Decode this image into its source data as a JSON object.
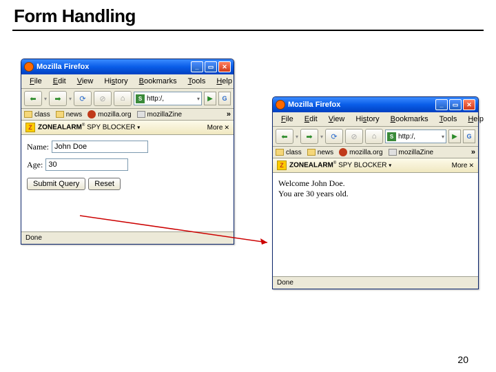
{
  "title": "Form Handling",
  "page_number": "20",
  "win1": {
    "title": "Mozilla Firefox",
    "menu": [
      "File",
      "Edit",
      "View",
      "History",
      "Bookmarks",
      "Tools",
      "Help"
    ],
    "addr": "http:/,",
    "bookmarks": [
      {
        "label": "class",
        "type": "folder"
      },
      {
        "label": "news",
        "type": "folder"
      },
      {
        "label": "mozilla.org",
        "type": "moz"
      },
      {
        "label": "mozillaZine",
        "type": "zine"
      }
    ],
    "za_brand": "ZONEALARM",
    "za_sub": "SPY BLOCKER",
    "za_more": "More",
    "form": {
      "name_label": "Name:",
      "name_value": "John Doe",
      "age_label": "Age:",
      "age_value": "30",
      "submit": "Submit Query",
      "reset": "Reset"
    },
    "status": "Done"
  },
  "win2": {
    "title": "Mozilla Firefox",
    "menu": [
      "File",
      "Edit",
      "View",
      "History",
      "Bookmarks",
      "Tools",
      "Help"
    ],
    "addr": "http:/,",
    "bookmarks": [
      {
        "label": "class",
        "type": "folder"
      },
      {
        "label": "news",
        "type": "folder"
      },
      {
        "label": "mozilla.org",
        "type": "moz"
      },
      {
        "label": "mozillaZine",
        "type": "zine"
      }
    ],
    "za_brand": "ZONEALARM",
    "za_sub": "SPY BLOCKER",
    "za_more": "More",
    "result_line1": "Welcome John Doe.",
    "result_line2": "You are 30 years old.",
    "status": "Done"
  }
}
